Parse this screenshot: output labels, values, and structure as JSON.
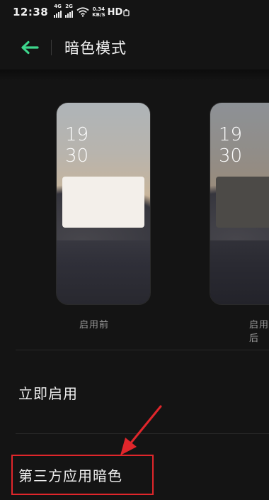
{
  "status_bar": {
    "time": "12:38",
    "sim1_type": "4G",
    "sim2_type": "2G",
    "speed_value": "0.34",
    "speed_unit": "KB/S",
    "hd": "HD"
  },
  "header": {
    "title": "暗色模式",
    "back_icon": "arrow-left-icon"
  },
  "previews": [
    {
      "clock_hour": "19",
      "clock_minute": "30",
      "label": "启用前"
    },
    {
      "clock_hour": "19",
      "clock_minute": "30",
      "label": "启用后"
    }
  ],
  "menu": {
    "enable_now": "立即启用",
    "third_party": "第三方应用暗色"
  },
  "colors": {
    "accent": "#3dd68c",
    "annotation": "#e0262b",
    "background": "#141414"
  }
}
